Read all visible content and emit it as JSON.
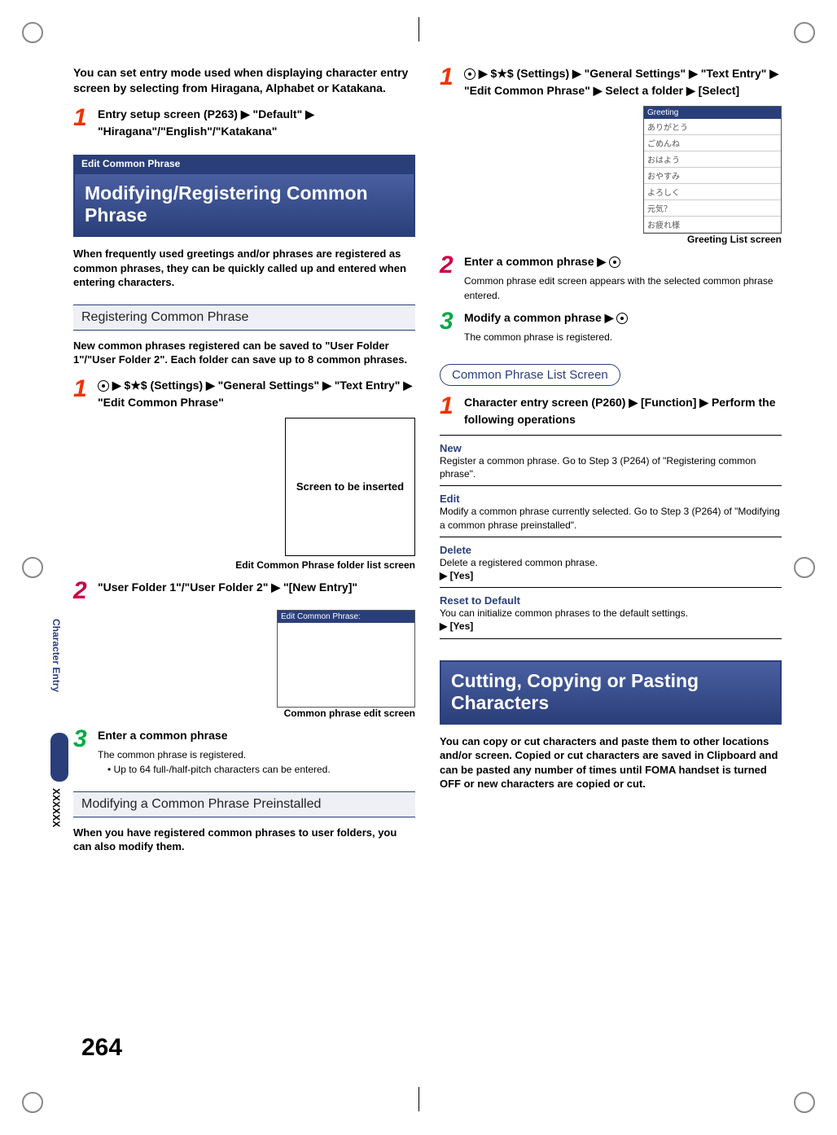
{
  "page_number": "264",
  "side_tab": "Character Entry",
  "side_x": "XXXXXX",
  "left": {
    "intro": "You can set entry mode used when displaying character entry screen by selecting from Hiragana, Alphabet or Katakana.",
    "step1": "Entry setup screen (P263) ▶ \"Default\" ▶ \"Hiragana\"/\"English\"/\"Katakana\"",
    "category": "Edit Common Phrase",
    "title": "Modifying/Registering Common Phrase",
    "desc1": "When frequently used greetings and/or phrases are registered as common phrases, they can be quickly called up and entered when entering characters.",
    "subA": "Registering Common Phrase",
    "descA": "New common phrases registered can be saved to \"User Folder 1\"/\"User Folder 2\". Each folder can save up to 8 common phrases.",
    "stepA1": " ▶ $★$ (Settings) ▶ \"General Settings\" ▶ \"Text Entry\" ▶ \"Edit Common Phrase\"",
    "placeholder": "Screen to be inserted",
    "captionA": "Edit Common Phrase folder list screen",
    "stepA2": "\"User Folder 1\"/\"User Folder 2\" ▶ \"[New Entry]\"",
    "shot2_bar": "Edit Common Phrase:",
    "captionB": "Common phrase edit screen",
    "stepA3_lead": "Enter a common phrase",
    "stepA3_sub": "The common phrase is registered.",
    "stepA3_bullet": "• Up to 64 full-/half-pitch characters can be entered.",
    "subB": "Modifying a Common Phrase Preinstalled",
    "descB": "When you have registered common phrases to user folders, you can also modify them."
  },
  "right": {
    "step1": " ▶ $★$ (Settings) ▶ \"General Settings\" ▶ \"Text Entry\" ▶ \"Edit Common Phrase\" ▶ Select a folder ▶  [Select]",
    "greeting_bar": "Greeting",
    "greeting_rows": [
      "ありがとう",
      "ごめんね",
      "おはよう",
      "おやすみ",
      "よろしく",
      "元気？",
      "お疲れ様"
    ],
    "captionA": "Greeting List screen",
    "step2_lead": "Enter a common phrase ▶ ",
    "step2_sub": "Common phrase edit screen appears with the selected common phrase entered.",
    "step3_lead": "Modify a common phrase ▶ ",
    "step3_sub": "The common phrase is registered.",
    "pill": "Common Phrase List Screen",
    "stepB1": "Character entry screen (P260) ▶  [Function] ▶ Perform the following operations",
    "opt_new_t": "New",
    "opt_new_b": "Register a common phrase. Go to Step 3 (P264) of \"Registering common phrase\".",
    "opt_edit_t": "Edit",
    "opt_edit_b": "Modify a common phrase currently selected. Go to Step 3 (P264) of \"Modifying a common phrase preinstalled\".",
    "opt_del_t": "Delete",
    "opt_del_b": "Delete a registered common phrase.",
    "opt_del_act": "▶  [Yes]",
    "opt_reset_t": "Reset to Default",
    "opt_reset_b": "You can initialize common phrases to the default settings.",
    "opt_reset_act": "▶  [Yes]",
    "title2": "Cutting, Copying or Pasting Characters",
    "desc2": "You can copy or cut characters and paste them to other locations and/or screen. Copied or cut characters are saved in Clipboard and can be pasted any number of times until FOMA handset is turned OFF or new characters are copied or cut."
  }
}
